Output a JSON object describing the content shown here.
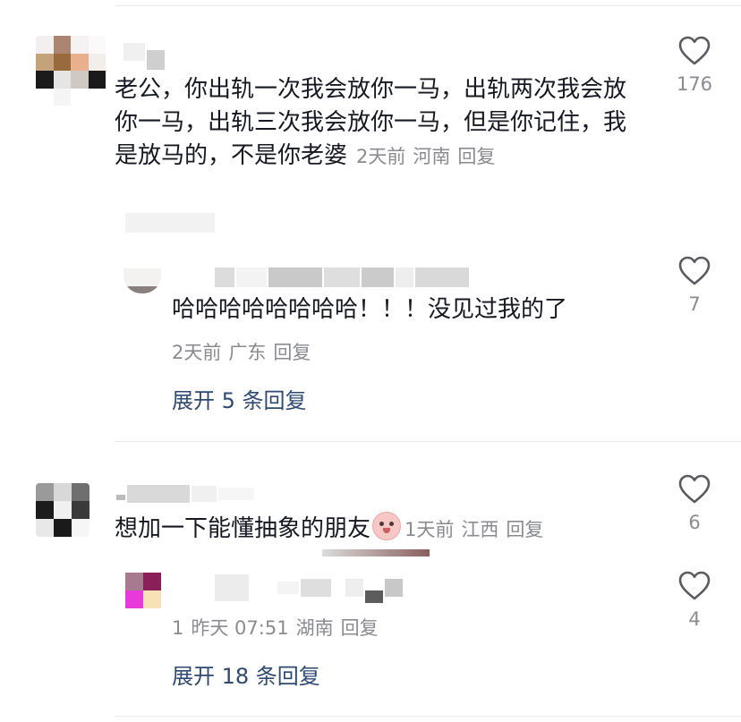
{
  "comments": [
    {
      "text": "老公，你出轨一次我会放你一马，出轨两次我会放你一马，出轨三次我会放你一马，但是你记住，我是放马的，不是你老婆",
      "time": "2天前",
      "location": "河南",
      "reply_label": "回复",
      "likes": "176",
      "replies": [
        {
          "text": "哈哈哈哈哈哈哈哈！！！没见过我的了",
          "time": "2天前",
          "location": "广东",
          "reply_label": "回复",
          "likes": "7"
        }
      ],
      "expand_label": "展开 5 条回复"
    },
    {
      "text": "想加一下能懂抽象的朋友",
      "emoji": "pig-face-emoji",
      "time": "1天前",
      "location": "江西",
      "reply_label": "回复",
      "likes": "6",
      "replies": [
        {
          "text": "1",
          "time": "昨天 07:51",
          "location": "湖南",
          "reply_label": "回复",
          "likes": "4"
        }
      ],
      "expand_label": "展开 18 条回复"
    }
  ],
  "colors": {
    "text": "#161823",
    "meta": "#8a8b91",
    "expand_link": "#2e4a73",
    "divider": "#ebebeb"
  },
  "icons": {
    "like": "heart-outline-icon"
  }
}
